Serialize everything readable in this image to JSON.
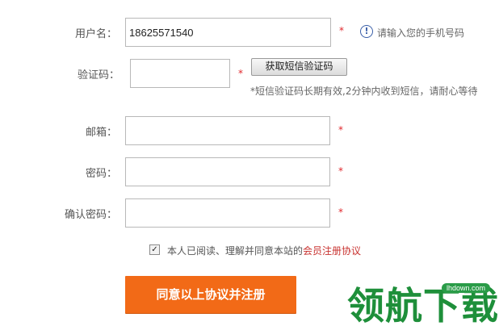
{
  "form": {
    "username": {
      "label": "用户名：",
      "value": "18625571540",
      "required_mark": "*",
      "hint": "请输入您的手机号码",
      "info_icon": "info-icon"
    },
    "captcha": {
      "label": "验证码：",
      "value": "",
      "required_mark": "*",
      "button_label": "获取短信验证码",
      "note": "*短信验证码长期有效,2分钟内收到短信，请耐心等待"
    },
    "email": {
      "label": "邮箱：",
      "value": "",
      "required_mark": "*"
    },
    "password": {
      "label": "密码：",
      "value": "",
      "required_mark": "*"
    },
    "confirm_password": {
      "label": "确认密码：",
      "value": "",
      "required_mark": "*"
    },
    "agreement": {
      "checked": true,
      "text": "本人已阅读、理解并同意本站的",
      "link_text": "会员注册协议"
    },
    "submit_label": "同意以上协议并注册"
  },
  "watermark": {
    "brand": "领航下载",
    "url": "lhdown.com"
  },
  "colors": {
    "accent": "#f26a17",
    "required": "#e0262b",
    "link": "#c8322f",
    "info": "#3a5fa8",
    "brand": "#1e8f3a"
  }
}
